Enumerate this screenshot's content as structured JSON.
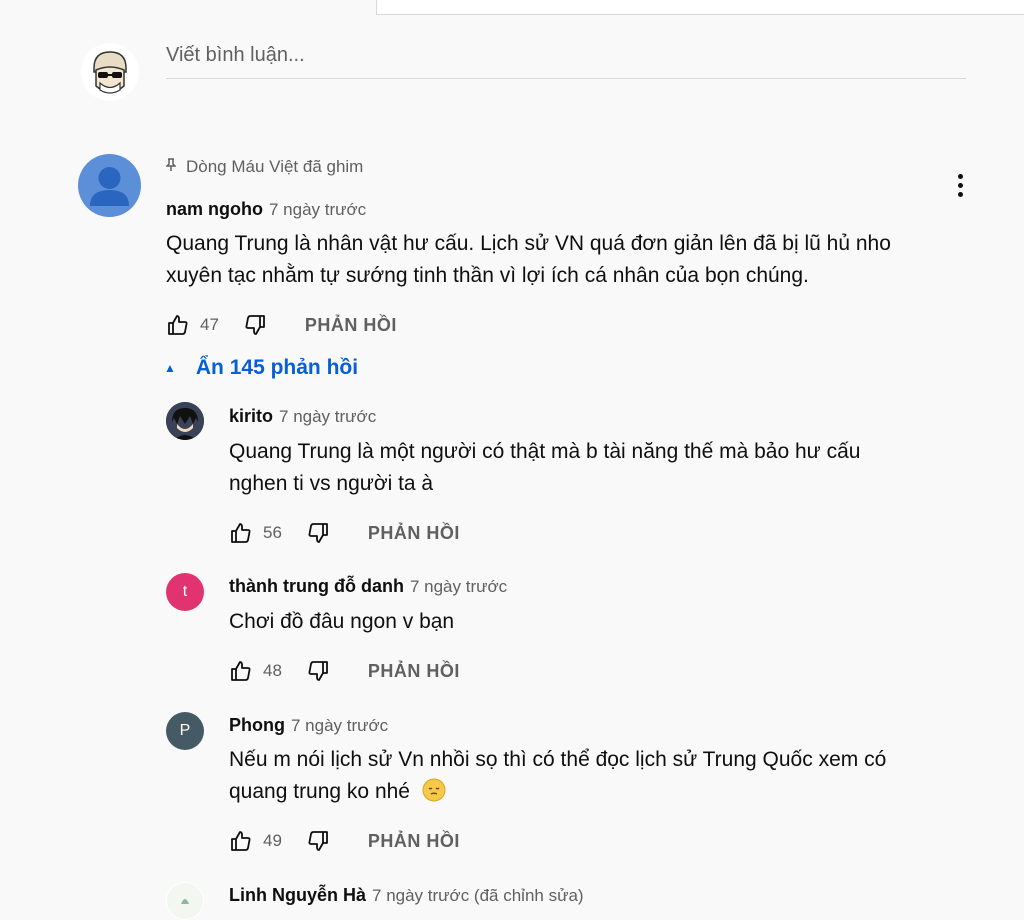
{
  "composer": {
    "placeholder": "Viết bình luận..."
  },
  "pinned": {
    "pin_text": "Dòng Máu Việt đã ghim",
    "author": "nam ngoho",
    "time": "7 ngày trước",
    "text_line1": "Quang Trung là nhân vật hư cấu. Lịch sử VN quá đơn giản lên đã bị lũ hủ nho",
    "text_line2": "xuyên tạc nhằm tự sướng tinh thần vì lợi ích cá nhân của bọn chúng.",
    "likes": "47",
    "reply_label": "PHẢN HỒI"
  },
  "replies_toggle": {
    "label": "Ẩn 145 phản hồi"
  },
  "replies": [
    {
      "author": "kirito",
      "time": "7 ngày trước",
      "text_line1": "Quang Trung là một người có thật mà b tài năng thế mà bảo hư cấu",
      "text_line2": "nghen ti vs người ta à",
      "likes": "56",
      "reply_label": "PHẢN HỒI"
    },
    {
      "author": "thành trung đỗ danh",
      "time": "7 ngày trước",
      "avatar_letter": "t",
      "text_line1": "Chơi đồ đâu ngon v bạn",
      "likes": "48",
      "reply_label": "PHẢN HỒI"
    },
    {
      "author": "Phong",
      "time": "7 ngày trước",
      "avatar_letter": "P",
      "text_line1": "Nếu m nói lịch sử Vn nhồi sọ thì có thể đọc lịch sử Trung Quốc xem có",
      "text_line2": "quang trung ko nhé",
      "likes": "49",
      "reply_label": "PHẢN HỒI"
    },
    {
      "author": "Linh Nguyễn Hà",
      "time": "7 ngày trước (đã chỉnh sửa)"
    }
  ],
  "colors": {
    "link_blue": "#065fd4",
    "avatar_default": "#5b8fd8",
    "avatar_t": "#e0336f",
    "avatar_p": "#455a64"
  },
  "icons": [
    "pin-icon",
    "thumbs-up-icon",
    "thumbs-down-icon",
    "kebab-menu-icon",
    "caret-up-icon",
    "smiley-icon"
  ]
}
